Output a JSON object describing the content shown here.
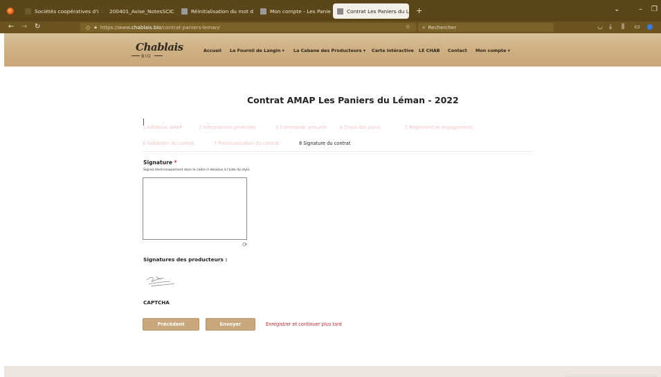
{
  "browser": {
    "tabs": [
      {
        "label": "Sociétés coopératives d'i"
      },
      {
        "label": "200401_Avise_NotesSCIC"
      },
      {
        "label": "Réinitialisation du mot de"
      },
      {
        "label": "Mon compte - Les Paniers"
      },
      {
        "label": "Contrat Les Paniers du Lé",
        "active": true
      }
    ],
    "new_tab": "+",
    "tab_close": "×",
    "url_prefix": "https://www.",
    "url_host": "chablais.bio",
    "url_path": "/contrat-paniers-leman/",
    "search_placeholder": "Rechercher",
    "icons": [
      "firefox-icon",
      "back-icon",
      "forward-icon",
      "reload-icon",
      "shield-icon",
      "lock-icon",
      "star-icon",
      "search-icon",
      "pocket-icon",
      "download-icon",
      "library-icon",
      "sidebar-icon",
      "extension-icon"
    ]
  },
  "site": {
    "logo": "Chablais",
    "logo_sub": "BIO",
    "menu": [
      {
        "label": "Accueil",
        "dropdown": false
      },
      {
        "label": "Le Fournil de Langin",
        "dropdown": true
      },
      {
        "label": "La Cabane des Producteurs",
        "dropdown": true
      },
      {
        "label": "Carte intéractive",
        "dropdown": false
      },
      {
        "label": "LE CHAB",
        "dropdown": false
      },
      {
        "label": "Contact",
        "dropdown": false
      },
      {
        "label": "Mon compte",
        "dropdown": true
      }
    ],
    "dropdown_glyph": "▾"
  },
  "form": {
    "title": "Contrat AMAP Les Paniers du Léman - 2022",
    "steps": [
      {
        "label": "1 Adhésion AMAP"
      },
      {
        "label": "2 Informations générales"
      },
      {
        "label": "3 Commande annuelle"
      },
      {
        "label": "4 Choix des pains"
      },
      {
        "label": "5 Règlement et engagements"
      },
      {
        "label": "6 Validation du contrat"
      },
      {
        "label": "7 Prévisualisation du contrat"
      },
      {
        "label": "8 Signature du contrat",
        "current": true
      }
    ],
    "signature_label": "Signature",
    "required_mark": "*",
    "signature_hint": "Signez électroniquement dans le cadre ci-dessous à l'aide du stylo.",
    "producers_label": "Signatures des producteurs :",
    "captcha_label": "CAPTCHA",
    "buttons": {
      "previous": "Précédent",
      "submit": "Envoyer",
      "save_later": "Enregistrer et continuer plus tard"
    },
    "colors": {
      "accent": "#c8a77b",
      "required": "#c1272d",
      "inactive_step": "#f0c3c3"
    }
  }
}
